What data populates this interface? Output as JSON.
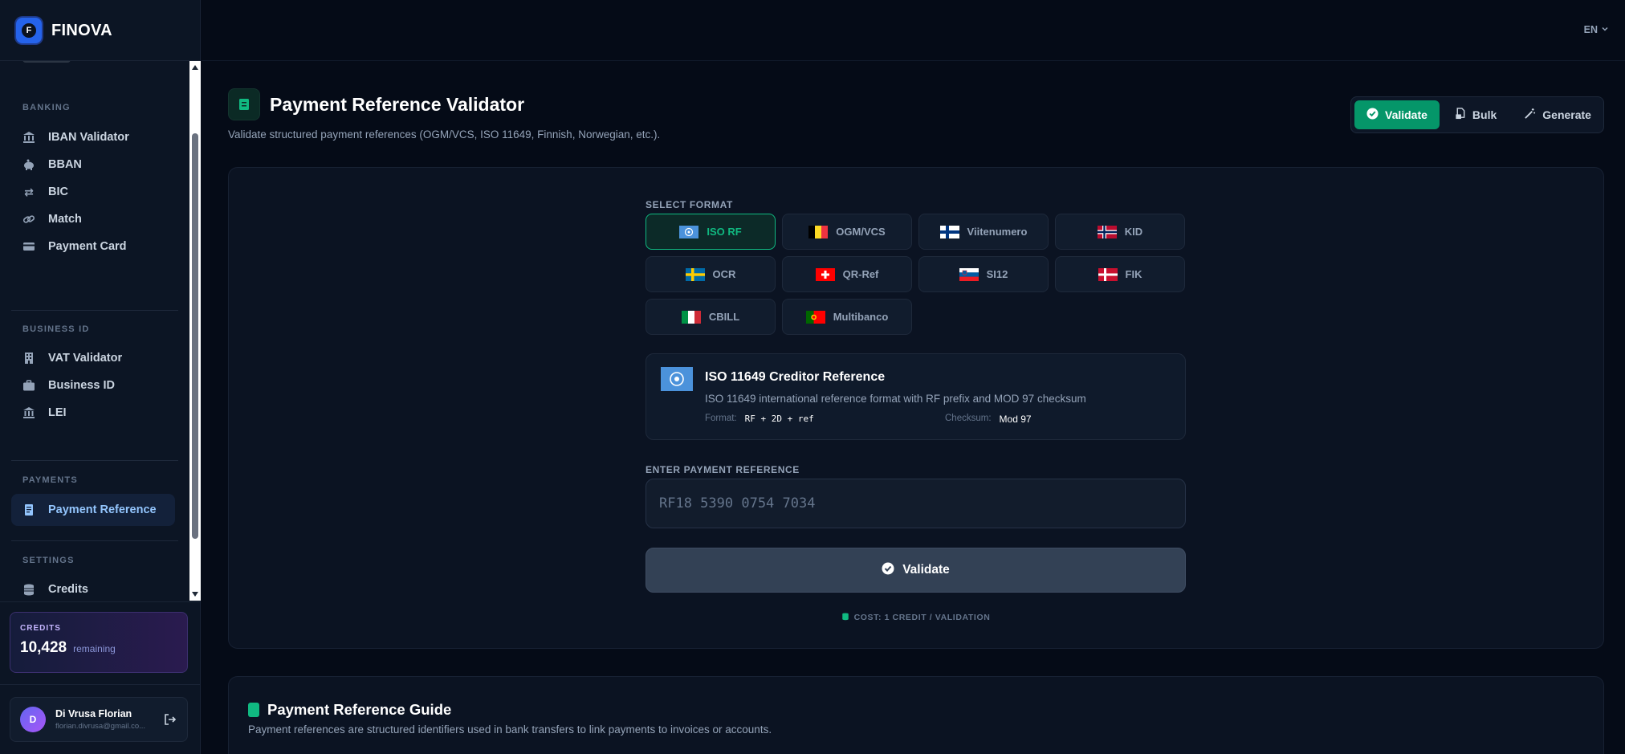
{
  "brand": {
    "name": "FINOVA",
    "logo_letter": "F"
  },
  "sidebar": {
    "sections": [
      {
        "label": "BANKING",
        "items": [
          {
            "label": "IBAN Validator",
            "icon": "bank-icon"
          },
          {
            "label": "BBAN",
            "icon": "piggy-bank-icon"
          },
          {
            "label": "BIC",
            "icon": "swap-arrows-icon"
          },
          {
            "label": "Match",
            "icon": "link-icon"
          },
          {
            "label": "Payment Card",
            "icon": "credit-card-icon"
          }
        ]
      },
      {
        "label": "BUSINESS ID",
        "items": [
          {
            "label": "VAT Validator",
            "icon": "building-icon"
          },
          {
            "label": "Business ID",
            "icon": "briefcase-icon"
          },
          {
            "label": "LEI",
            "icon": "institution-icon"
          }
        ]
      },
      {
        "label": "PAYMENTS",
        "items": [
          {
            "label": "Payment Reference",
            "icon": "receipt-icon",
            "active": true
          }
        ]
      },
      {
        "label": "SETTINGS",
        "items": [
          {
            "label": "Credits",
            "icon": "coins-icon"
          }
        ]
      }
    ],
    "credits": {
      "label": "CREDITS",
      "value": "10,428",
      "suffix": "remaining"
    },
    "user": {
      "initial": "D",
      "name": "Di Vrusa Florian",
      "email": "florian.divrusa@gmail.co..."
    }
  },
  "topbar": {
    "language": "EN"
  },
  "page": {
    "title": "Payment Reference Validator",
    "subtitle": "Validate structured payment references (OGM/VCS, ISO 11649, Finnish, Norwegian, etc.).",
    "modes": [
      {
        "label": "Validate",
        "icon": "check-circle-icon",
        "active": true
      },
      {
        "label": "Bulk",
        "icon": "file-stack-icon"
      },
      {
        "label": "Generate",
        "icon": "magic-wand-icon"
      }
    ]
  },
  "validator": {
    "select_label": "SELECT FORMAT",
    "formats": [
      {
        "label": "ISO RF",
        "flag": "un",
        "active": true
      },
      {
        "label": "OGM/VCS",
        "flag": "be"
      },
      {
        "label": "Viitenumero",
        "flag": "fi"
      },
      {
        "label": "KID",
        "flag": "no"
      },
      {
        "label": "OCR",
        "flag": "se"
      },
      {
        "label": "QR-Ref",
        "flag": "ch"
      },
      {
        "label": "SI12",
        "flag": "si"
      },
      {
        "label": "FIK",
        "flag": "dk"
      },
      {
        "label": "CBILL",
        "flag": "it"
      },
      {
        "label": "Multibanco",
        "flag": "pt"
      }
    ],
    "info": {
      "title": "ISO 11649 Creditor Reference",
      "description": "ISO 11649 international reference format with RF prefix and MOD 97 checksum",
      "format_label": "Format:",
      "format_value": "RF + 2D + ref",
      "checksum_label": "Checksum:",
      "checksum_value": "Mod 97"
    },
    "input_label": "ENTER PAYMENT REFERENCE",
    "input_placeholder": "RF18 5390 0754 7034",
    "input_value": "",
    "validate_label": "Validate",
    "cost": "COST: 1 CREDIT / VALIDATION"
  },
  "guide": {
    "title": "Payment Reference Guide",
    "description": "Payment references are structured identifiers used in bank transfers to link payments to invoices or accounts."
  }
}
